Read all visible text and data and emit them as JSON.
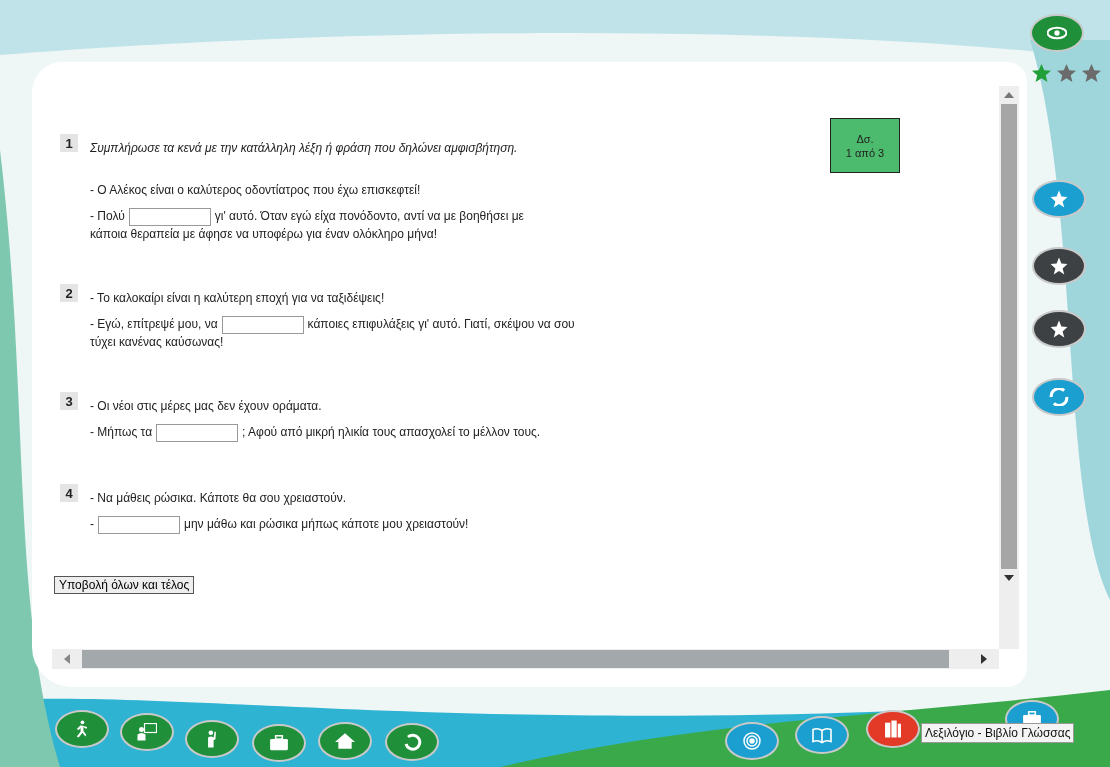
{
  "counter": {
    "label": "Δσ.",
    "value": "1 από 3"
  },
  "stars": 1,
  "exercises": [
    {
      "number": "1",
      "lines": [
        {
          "kind": "instruction",
          "parts": [
            {
              "kind": "text",
              "text": "Συμπλήρωσε τα κενά με την κατάλληλη λέξη ή φράση που δηλώνει αμφισβήτηση."
            }
          ]
        },
        {
          "kind": "dialogue",
          "parts": [
            {
              "kind": "text",
              "text": "- Ο Αλέκος είναι ο καλύτερος οδοντίατρος που έχω επισκεφτεί!"
            }
          ]
        },
        {
          "kind": "dialogue",
          "parts": [
            {
              "kind": "text",
              "text": "- Πολύ"
            },
            {
              "kind": "blank"
            },
            {
              "kind": "text",
              "text": "γι' αυτό. Όταν εγώ είχα πονόδοντο, αντί να με βοηθήσει με"
            },
            {
              "kind": "break"
            },
            {
              "kind": "text",
              "text": "κάποια θεραπεία με άφησε να υποφέρω για έναν ολόκληρο μήνα!"
            }
          ]
        }
      ]
    },
    {
      "number": "2",
      "lines": [
        {
          "kind": "dialogue",
          "parts": [
            {
              "kind": "text",
              "text": "- Το καλοκαίρι είναι η καλύτερη εποχή για να ταξιδέψεις!"
            }
          ]
        },
        {
          "kind": "dialogue",
          "parts": [
            {
              "kind": "text",
              "text": "- Εγώ, επίτρεψέ μου, να"
            },
            {
              "kind": "blank"
            },
            {
              "kind": "text",
              "text": "κάποιες επιφυλάξεις γι' αυτό. Γιατί, σκέψου να σου"
            },
            {
              "kind": "break"
            },
            {
              "kind": "text",
              "text": "τύχει κανένας καύσωνας!"
            }
          ]
        }
      ]
    },
    {
      "number": "3",
      "lines": [
        {
          "kind": "dialogue",
          "parts": [
            {
              "kind": "text",
              "text": "- Οι νέοι στις μέρες μας δεν έχουν οράματα."
            }
          ]
        },
        {
          "kind": "dialogue",
          "parts": [
            {
              "kind": "text",
              "text": "- Μήπως τα"
            },
            {
              "kind": "blank"
            },
            {
              "kind": "text",
              "text": "; Αφού από μικρή ηλικία τους απασχολεί το μέλλον τους."
            }
          ]
        }
      ]
    },
    {
      "number": "4",
      "lines": [
        {
          "kind": "dialogue",
          "parts": [
            {
              "kind": "text",
              "text": "-  Να μάθεις ρώσικα. Κάποτε θα σου χρειαστούν."
            }
          ]
        },
        {
          "kind": "dialogue",
          "parts": [
            {
              "kind": "text",
              "text": "-"
            },
            {
              "kind": "blank"
            },
            {
              "kind": "text",
              "text": "μην μάθω και ρώσικα μήπως κάποτε μου χρειαστούν!"
            }
          ]
        }
      ]
    }
  ],
  "submit_button": "Υποβολή όλων και τέλος",
  "tooltip": "Λεξιλόγιο - Βιβλίο Γλώσσας"
}
